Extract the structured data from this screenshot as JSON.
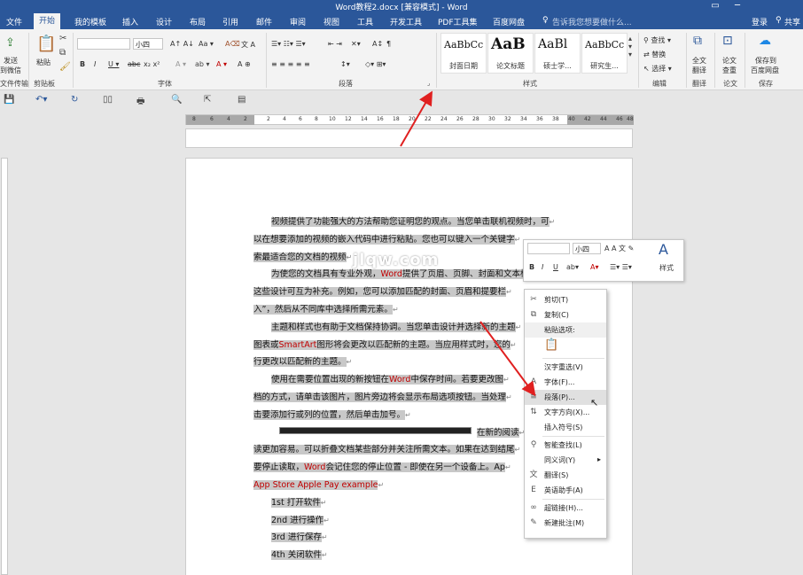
{
  "window": {
    "title": "Word教程2.docx [兼容模式] - Word",
    "restore_icon": "restore-icon",
    "min_icon": "minimize-icon"
  },
  "tabs": [
    "文件",
    "开始",
    "我的模板",
    "插入",
    "设计",
    "布局",
    "引用",
    "邮件",
    "审阅",
    "视图",
    "工具",
    "开发工具",
    "PDF工具集",
    "百度网盘"
  ],
  "tell_me": "告诉我您想要做什么...",
  "account": {
    "login": "登录",
    "share": "共享"
  },
  "ribbon": {
    "send_label1": "发送",
    "send_label2": "到微信",
    "send_group": "文件传输",
    "paste_label": "粘贴",
    "clipboard_group": "剪贴板",
    "font_name": "",
    "font_size": "小四",
    "font_group": "字体",
    "paragraph_group": "段落",
    "styles": [
      {
        "preview": "AaBbCc",
        "caption": "封面日期"
      },
      {
        "preview": "AaB",
        "caption": "论文标题"
      },
      {
        "preview": "AaBl",
        "caption": "硕士学..."
      },
      {
        "preview": "AaBbCc",
        "caption": "研究生..."
      }
    ],
    "styles_group": "样式",
    "find": "查找",
    "replace": "替换",
    "select": "选择",
    "edit_group": "编辑",
    "translate_full1": "全文",
    "translate_full2": "翻译",
    "translate_group": "翻译",
    "check1": "论文",
    "check2": "查重",
    "paper_group": "论文",
    "save_baidu1": "保存到",
    "save_baidu2": "百度网盘",
    "save_group": "保存"
  },
  "ruler_numbers": [
    "8",
    "6",
    "4",
    "2",
    "2",
    "4",
    "6",
    "8",
    "10",
    "12",
    "14",
    "16",
    "18",
    "20",
    "22",
    "24",
    "26",
    "28",
    "30",
    "32",
    "34",
    "36",
    "38",
    "40",
    "42",
    "44",
    "46",
    "48"
  ],
  "document": {
    "lines": [
      {
        "text": "视频提供了功能强大的方法帮助您证明您的观点。当您单击联机视频时，可",
        "indent": true
      },
      {
        "text": "以在想要添加的视频的嵌入代码中进行粘贴。您也可以键入一个关键字",
        "indent": false
      },
      {
        "text": "索最适合您的文档的视频",
        "indent": false
      },
      {
        "pre": "为使您的文档具有专业外观，",
        "red": "Word",
        "post": "提供了页眉、页脚、封面和文本框",
        "indent": true
      },
      {
        "text": "这些设计可互为补充。例如，您可以添加匹配的封面、页眉和提要栏",
        "indent": false
      },
      {
        "text": "入”，然后从不同库中选择所需元素。",
        "indent": false
      },
      {
        "text": "主题和样式也有助于文档保持协调。当您单击设计并选择新的主题",
        "indent": true
      },
      {
        "pre": "图表或",
        "red": "SmartArt",
        "post": "图形将会更改以匹配新的主题。当应用样式时，您的",
        "indent": false
      },
      {
        "text": "行更改以匹配新的主题。",
        "indent": false
      },
      {
        "pre": "使用在需要位置出现的新按钮在",
        "red": "Word",
        "post": "中保存时间。若要更改图",
        "indent": true
      },
      {
        "text": "档的方式，请单击该图片，图片旁边将会显示布局选项按钮。当处理",
        "indent": false
      },
      {
        "text": "击要添加行或列的位置，然后单击加号。",
        "indent": false
      },
      {
        "text": "在新的阅读",
        "indent": false,
        "offset": 252
      },
      {
        "text": "读更加容易。可以折叠文档某些部分并关注所需文本。如果在达到结尾",
        "indent": false
      },
      {
        "pre": "要停止读取，",
        "red": "Word",
        "post": "会记住您的停止位置 - 即使在另一个设备上。Ap",
        "indent": false
      },
      {
        "red": "App Store  Apple Pay  example",
        "indent": false
      },
      {
        "text": "1st 打开软件",
        "indent": true
      },
      {
        "text": "2nd 进行操作",
        "indent": true
      },
      {
        "text": "3rd 进行保存",
        "indent": true
      },
      {
        "text": "4th 关闭软件",
        "indent": true
      }
    ],
    "watermark": "jlqw.com"
  },
  "mini_toolbar": {
    "font_name": "",
    "font_size": "小四",
    "styles_label": "样式"
  },
  "context_menu": [
    {
      "label": "剪切(T)",
      "icon": "scissors-icon",
      "sep_before": false
    },
    {
      "label": "复制(C)",
      "icon": "copy-icon",
      "sep_before": false
    },
    {
      "label": "粘贴选项:",
      "icon": "paste-icon",
      "sep_before": false,
      "header": true
    },
    {
      "label": "",
      "icon": "clipboard-icon",
      "sep_before": false,
      "paste_btn": true
    },
    {
      "label": "汉字重选(V)",
      "icon": "",
      "sep_before": true
    },
    {
      "label": "字体(F)...",
      "icon": "font-icon",
      "sep_before": false
    },
    {
      "label": "段落(P)...",
      "icon": "paragraph-icon",
      "sep_before": false,
      "hover": true
    },
    {
      "label": "文字方向(X)...",
      "icon": "text-direction-icon",
      "sep_before": false
    },
    {
      "label": "插入符号(S)",
      "icon": "",
      "sep_before": false
    },
    {
      "label": "智能查找(L)",
      "icon": "search-icon",
      "sep_before": true
    },
    {
      "label": "同义词(Y)",
      "icon": "",
      "sep_before": false,
      "submenu": true
    },
    {
      "label": "翻译(S)",
      "icon": "translate-icon",
      "sep_before": false
    },
    {
      "label": "英语助手(A)",
      "icon": "english-icon",
      "sep_before": false
    },
    {
      "label": "超链接(H)...",
      "icon": "link-icon",
      "sep_before": true
    },
    {
      "label": "新建批注(M)",
      "icon": "comment-icon",
      "sep_before": false
    }
  ],
  "colors": {
    "brand": "#2b579a",
    "red_text": "#c00000",
    "highlight": "#c8c8c8",
    "annotation_arrow": "#e02020"
  }
}
